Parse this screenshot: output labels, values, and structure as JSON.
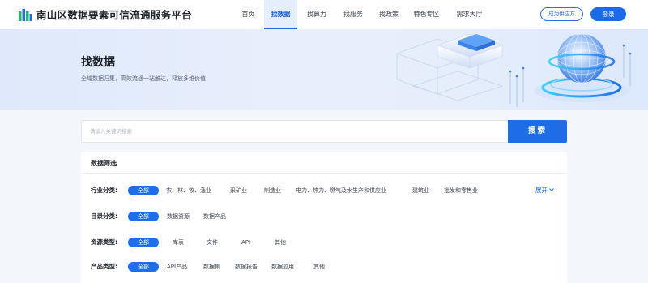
{
  "header": {
    "site_title": "南山区数据要素可信流通服务平台",
    "nav": [
      "首页",
      "找数据",
      "找算力",
      "找服务",
      "找政策",
      "特色专区",
      "需求大厅"
    ],
    "active_nav": "找数据",
    "supplier_button": "成为供应方",
    "login_button": "登录"
  },
  "banner": {
    "title": "找数据",
    "subtitle": "全域数据归集，高效流通一站触达，释放多维价值"
  },
  "search": {
    "placeholder": "请输入关键词搜索",
    "button": "搜索"
  },
  "filters": {
    "title": "数据筛选",
    "expand_label": "展开",
    "rows": [
      {
        "label": "行业分类:",
        "options": [
          "全部",
          "农、林、牧、渔业",
          "采矿业",
          "制造业",
          "电力、热力、燃气及水生产和供应业",
          "建筑业",
          "批发和零售业"
        ]
      },
      {
        "label": "目录分类:",
        "options": [
          "全部",
          "数据资源",
          "数据产品"
        ]
      },
      {
        "label": "资源类型:",
        "options": [
          "全部",
          "库表",
          "文件",
          "API",
          "其他"
        ]
      },
      {
        "label": "产品类型:",
        "options": [
          "全部",
          "API产品",
          "数据集",
          "数据报告",
          "数据应用",
          "其他"
        ]
      }
    ]
  },
  "colors": {
    "accent": "#1f6ee8",
    "nav_active_bg": "#e4eefc",
    "page_bg": "#f3f6fa"
  }
}
